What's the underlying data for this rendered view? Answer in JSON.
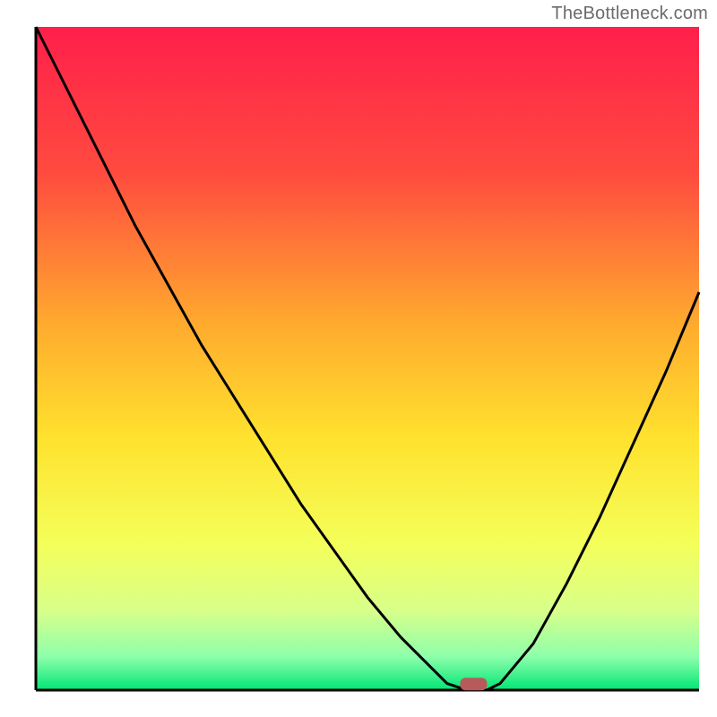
{
  "watermark": "TheBottleneck.com",
  "chart_data": {
    "type": "line",
    "title": "",
    "xlabel": "",
    "ylabel": "",
    "x": [
      0.0,
      0.05,
      0.1,
      0.15,
      0.2,
      0.25,
      0.3,
      0.35,
      0.4,
      0.45,
      0.5,
      0.55,
      0.6,
      0.62,
      0.65,
      0.68,
      0.7,
      0.75,
      0.8,
      0.85,
      0.9,
      0.95,
      1.0
    ],
    "values": [
      1.0,
      0.9,
      0.8,
      0.7,
      0.61,
      0.52,
      0.44,
      0.36,
      0.28,
      0.21,
      0.14,
      0.08,
      0.03,
      0.01,
      0.0,
      0.0,
      0.01,
      0.07,
      0.16,
      0.26,
      0.37,
      0.48,
      0.6
    ],
    "marker": {
      "x": 0.66,
      "y": 0.005
    },
    "xlim": [
      0,
      1
    ],
    "ylim": [
      0,
      1
    ]
  },
  "colors": {
    "axis": "#000000",
    "curve": "#000000",
    "marker": "#b75a5a",
    "gradient_top": "#ff1f4b",
    "gradient_mid1": "#ff6b3a",
    "gradient_mid2": "#ffd22e",
    "gradient_mid3": "#f7ff4a",
    "gradient_mid4": "#c9ff7a",
    "gradient_bottom": "#00e676"
  }
}
